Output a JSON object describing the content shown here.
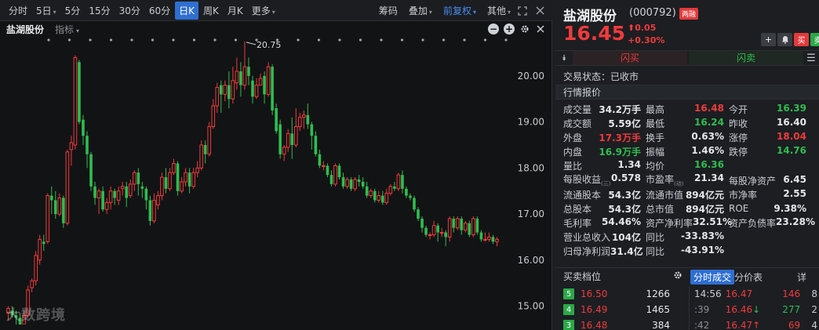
{
  "toolbar": {
    "tabs": [
      {
        "label": "分时",
        "active": false
      },
      {
        "label": "5日",
        "active": false,
        "caret": true
      },
      {
        "label": "5分",
        "active": false
      },
      {
        "label": "15分",
        "active": false
      },
      {
        "label": "30分",
        "active": false
      },
      {
        "label": "60分",
        "active": false
      },
      {
        "label": "日K",
        "active": true
      },
      {
        "label": "周K",
        "active": false
      },
      {
        "label": "月K",
        "active": false
      },
      {
        "label": "更多",
        "active": false,
        "caret": true
      }
    ],
    "right": {
      "chip": "筹码",
      "overlay": "叠加",
      "adjust": "前复权",
      "other": "其他"
    }
  },
  "chart_header": {
    "stock": "盐湖股份",
    "indicator": "指标"
  },
  "chart_data": {
    "type": "candlestick",
    "y_ticks": [
      "20.00",
      "19.00",
      "18.00",
      "17.00",
      "16.00",
      "15.00"
    ],
    "ylim": [
      14.6,
      20.85
    ],
    "max_label": "20.75",
    "colors": {
      "up": "#ef3b3b",
      "down": "#2fbd4f"
    },
    "candles": [
      [
        14.85,
        14.95,
        14.7,
        15.0
      ],
      [
        14.9,
        14.8,
        14.75,
        15.0
      ],
      [
        14.8,
        14.75,
        14.6,
        14.9
      ],
      [
        14.75,
        14.6,
        14.5,
        14.85
      ],
      [
        14.6,
        14.8,
        14.55,
        14.9
      ],
      [
        14.8,
        15.35,
        14.75,
        15.45
      ],
      [
        15.4,
        15.55,
        15.3,
        15.6
      ],
      [
        15.55,
        16.1,
        15.45,
        16.2
      ],
      [
        16.0,
        16.45,
        15.9,
        16.55
      ],
      [
        16.4,
        16.35,
        16.2,
        16.55
      ],
      [
        16.4,
        17.4,
        16.35,
        17.45
      ],
      [
        17.4,
        17.3,
        17.0,
        17.6
      ],
      [
        17.3,
        17.0,
        16.9,
        17.5
      ],
      [
        17.0,
        17.35,
        16.95,
        17.45
      ],
      [
        17.35,
        16.8,
        16.7,
        17.4
      ],
      [
        16.8,
        18.35,
        16.75,
        18.4
      ],
      [
        18.4,
        18.55,
        18.05,
        18.7
      ],
      [
        18.5,
        20.4,
        18.4,
        20.45
      ],
      [
        20.3,
        19.0,
        18.95,
        20.35
      ],
      [
        19.05,
        18.7,
        18.5,
        19.15
      ],
      [
        18.7,
        18.3,
        18.0,
        18.8
      ],
      [
        18.3,
        17.6,
        17.5,
        18.35
      ],
      [
        17.6,
        17.35,
        17.2,
        17.7
      ],
      [
        17.35,
        17.5,
        17.0,
        17.55
      ],
      [
        17.5,
        17.1,
        17.05,
        17.6
      ],
      [
        17.1,
        17.25,
        17.0,
        17.35
      ],
      [
        17.25,
        17.5,
        17.1,
        17.6
      ],
      [
        17.5,
        17.35,
        17.2,
        17.55
      ],
      [
        17.3,
        17.5,
        17.2,
        17.6
      ],
      [
        17.55,
        17.6,
        17.4,
        17.7
      ],
      [
        17.6,
        17.35,
        17.15,
        17.7
      ],
      [
        17.4,
        17.65,
        17.35,
        17.75
      ],
      [
        17.65,
        17.9,
        17.5,
        17.95
      ],
      [
        17.9,
        17.65,
        17.4,
        18.0
      ],
      [
        17.6,
        17.55,
        17.35,
        17.7
      ],
      [
        17.55,
        17.3,
        17.1,
        17.6
      ],
      [
        17.3,
        16.85,
        16.75,
        17.4
      ],
      [
        16.85,
        17.3,
        16.8,
        17.45
      ],
      [
        17.2,
        17.4,
        17.1,
        17.5
      ],
      [
        17.4,
        17.8,
        17.3,
        17.9
      ],
      [
        17.8,
        17.55,
        17.45,
        18.0
      ],
      [
        17.55,
        17.9,
        17.5,
        18.0
      ],
      [
        17.9,
        18.1,
        17.85,
        18.2
      ],
      [
        18.1,
        17.5,
        17.4,
        18.15
      ],
      [
        17.5,
        17.7,
        17.45,
        17.8
      ],
      [
        17.7,
        17.9,
        17.6,
        18.0
      ],
      [
        17.9,
        17.6,
        17.45,
        18.0
      ],
      [
        17.6,
        17.9,
        17.55,
        18.0
      ],
      [
        17.9,
        18.0,
        17.8,
        18.15
      ],
      [
        18.0,
        18.5,
        17.95,
        18.6
      ],
      [
        18.5,
        18.3,
        18.1,
        18.6
      ],
      [
        18.3,
        18.9,
        18.25,
        19.0
      ],
      [
        18.9,
        19.35,
        18.85,
        19.5
      ],
      [
        19.35,
        19.75,
        19.2,
        19.85
      ],
      [
        19.8,
        19.6,
        19.2,
        19.9
      ],
      [
        19.6,
        19.8,
        19.45,
        19.9
      ],
      [
        19.8,
        19.5,
        19.3,
        20.1
      ],
      [
        19.5,
        19.9,
        19.4,
        20.2
      ],
      [
        19.85,
        20.1,
        19.7,
        20.4
      ],
      [
        20.1,
        19.8,
        19.55,
        20.3
      ],
      [
        19.8,
        20.2,
        19.7,
        20.75
      ],
      [
        20.2,
        20.0,
        19.8,
        20.4
      ],
      [
        19.9,
        19.55,
        19.4,
        20.0
      ],
      [
        19.55,
        19.8,
        19.5,
        19.95
      ],
      [
        19.8,
        19.95,
        19.8,
        20.05
      ],
      [
        20.0,
        19.6,
        19.4,
        20.1
      ],
      [
        19.6,
        20.2,
        19.55,
        20.3
      ],
      [
        20.2,
        19.25,
        19.15,
        20.25
      ],
      [
        19.3,
        18.8,
        18.75,
        19.4
      ],
      [
        18.95,
        18.3,
        18.2,
        19.05
      ],
      [
        18.3,
        18.45,
        18.15,
        18.5
      ],
      [
        18.45,
        18.75,
        18.35,
        18.85
      ],
      [
        18.75,
        18.5,
        18.2,
        19.1
      ],
      [
        18.5,
        18.9,
        18.45,
        19.3
      ],
      [
        18.9,
        19.1,
        18.8,
        19.2
      ],
      [
        19.1,
        19.15,
        18.85,
        19.25
      ],
      [
        19.15,
        18.95,
        18.85,
        19.4
      ],
      [
        18.95,
        18.7,
        18.4,
        19.0
      ],
      [
        18.7,
        18.3,
        18.25,
        18.8
      ],
      [
        18.3,
        18.05,
        18.0,
        18.4
      ],
      [
        18.05,
        18.05,
        17.95,
        18.15
      ],
      [
        18.05,
        17.85,
        17.8,
        18.1
      ],
      [
        17.85,
        17.65,
        17.6,
        17.95
      ],
      [
        17.65,
        18.05,
        17.6,
        18.1
      ],
      [
        18.05,
        17.8,
        17.75,
        18.1
      ],
      [
        17.8,
        17.6,
        17.55,
        17.9
      ],
      [
        17.6,
        17.75,
        17.55,
        17.8
      ],
      [
        17.75,
        17.55,
        17.5,
        17.8
      ],
      [
        17.55,
        17.75,
        17.5,
        17.8
      ],
      [
        17.75,
        17.7,
        17.6,
        17.85
      ],
      [
        17.7,
        17.6,
        17.55,
        17.8
      ],
      [
        17.6,
        17.4,
        17.35,
        17.7
      ],
      [
        17.4,
        17.5,
        17.35,
        17.55
      ],
      [
        17.5,
        17.3,
        17.25,
        17.55
      ],
      [
        17.3,
        17.4,
        17.25,
        17.5
      ],
      [
        17.4,
        17.25,
        17.2,
        17.5
      ],
      [
        17.25,
        17.45,
        17.2,
        17.55
      ],
      [
        17.45,
        17.6,
        17.4,
        17.65
      ],
      [
        17.6,
        17.55,
        17.5,
        17.7
      ],
      [
        17.55,
        17.85,
        17.5,
        17.9
      ],
      [
        17.85,
        17.55,
        17.45,
        17.95
      ],
      [
        17.55,
        17.4,
        17.35,
        17.6
      ],
      [
        17.4,
        17.35,
        17.3,
        17.45
      ],
      [
        17.35,
        17.1,
        17.05,
        17.4
      ],
      [
        17.1,
        16.9,
        16.85,
        17.15
      ],
      [
        16.9,
        16.7,
        16.6,
        16.95
      ],
      [
        16.7,
        16.55,
        16.5,
        16.75
      ],
      [
        16.55,
        16.55,
        16.45,
        16.6
      ],
      [
        16.55,
        16.75,
        16.5,
        16.85
      ],
      [
        16.75,
        16.6,
        16.4,
        16.8
      ],
      [
        16.6,
        16.6,
        16.5,
        16.7
      ],
      [
        16.6,
        16.5,
        16.3,
        16.65
      ],
      [
        16.5,
        16.9,
        16.4,
        16.95
      ],
      [
        16.9,
        16.7,
        16.6,
        16.95
      ],
      [
        16.7,
        16.9,
        16.65,
        16.95
      ],
      [
        16.9,
        16.65,
        16.55,
        16.95
      ],
      [
        16.65,
        16.8,
        16.6,
        16.85
      ],
      [
        16.8,
        16.55,
        16.5,
        16.85
      ],
      [
        16.55,
        16.9,
        16.5,
        16.95
      ],
      [
        16.9,
        16.6,
        16.55,
        16.95
      ],
      [
        16.6,
        16.45,
        16.4,
        16.65
      ],
      [
        16.45,
        16.45,
        16.4,
        16.6
      ],
      [
        16.45,
        16.5,
        16.4,
        16.6
      ],
      [
        16.5,
        16.4,
        16.35,
        16.55
      ],
      [
        16.4,
        16.45,
        16.3,
        16.5
      ]
    ]
  },
  "watermark": "大数跨境",
  "stock": {
    "name": "盐湖股份",
    "code": "(000792)",
    "badge": "两融",
    "price": "16.45",
    "change": "0.05",
    "change_pct": "+0.30%"
  },
  "header_buttons": {
    "add": "+",
    "bell": "♪",
    "buy": "买",
    "sell": "卖"
  },
  "flash": {
    "buy": "闪买",
    "sell": "闪卖"
  },
  "trade_status": "交易状态：已收市",
  "quote_title": "行情报价",
  "quotes": [
    [
      {
        "label": "成交量",
        "value": "34.2万手",
        "color": "white"
      },
      {
        "label": "最高",
        "value": "16.48",
        "color": "red"
      },
      {
        "label": "今开",
        "value": "16.39",
        "color": "green"
      }
    ],
    [
      {
        "label": "成交额",
        "value": "5.59亿",
        "color": "white"
      },
      {
        "label": "最低",
        "value": "16.24",
        "color": "green"
      },
      {
        "label": "昨收",
        "value": "16.40",
        "color": "white"
      }
    ],
    [
      {
        "label": "外盘",
        "value": "17.3万手",
        "color": "red"
      },
      {
        "label": "换手",
        "value": "0.63%",
        "color": "white"
      },
      {
        "label": "涨停",
        "value": "18.04",
        "color": "red"
      }
    ],
    [
      {
        "label": "内盘",
        "value": "16.9万手",
        "color": "green"
      },
      {
        "label": "振幅",
        "value": "1.46%",
        "color": "white"
      },
      {
        "label": "跌停",
        "value": "14.76",
        "color": "green"
      }
    ],
    [
      {
        "label": "量比",
        "value": "1.34",
        "color": "white"
      },
      {
        "label": "均价",
        "value": "16.36",
        "color": "green"
      },
      {
        "label": "",
        "value": "",
        "color": "white"
      }
    ],
    [
      {
        "label": "每股收益",
        "sub": "(三)",
        "value": "0.578",
        "color": "white"
      },
      {
        "label": "市盈率",
        "sub": "(动)",
        "value": "21.34",
        "color": "white"
      },
      {
        "label": "每股净资产",
        "value": "6.45",
        "color": "white"
      }
    ],
    [
      {
        "label": "流通股本",
        "value": "54.3亿",
        "color": "white"
      },
      {
        "label": "流通市值",
        "value": "894亿元",
        "color": "white"
      },
      {
        "label": "市净率",
        "value": "2.55",
        "color": "white"
      }
    ],
    [
      {
        "label": "总股本",
        "value": "54.3亿",
        "color": "white"
      },
      {
        "label": "总市值",
        "value": "894亿元",
        "color": "white"
      },
      {
        "label": "ROE",
        "value": "9.38%",
        "color": "white"
      }
    ],
    [
      {
        "label": "毛利率",
        "value": "54.46%",
        "color": "white"
      },
      {
        "label": "资产净利率",
        "value": "32.51%",
        "color": "white"
      },
      {
        "label": "资产负债率",
        "value": "23.28%",
        "color": "white"
      }
    ],
    [
      {
        "label": "营业总收入",
        "value": "104亿",
        "color": "white"
      },
      {
        "label": "同比",
        "value": "-33.83%",
        "color": "white"
      },
      {
        "label": "",
        "value": "",
        "color": "white"
      }
    ],
    [
      {
        "label": "归母净利润",
        "value": "31.4亿",
        "color": "white"
      },
      {
        "label": "同比",
        "value": "-43.91%",
        "color": "white"
      },
      {
        "label": "",
        "value": "",
        "color": "white"
      }
    ]
  ],
  "orderbook": {
    "title": "买卖档位",
    "tab_ticks": "分时成交",
    "tab_price": "分价表",
    "tab_detail": "详",
    "rows": [
      {
        "level": "5",
        "price": "16.50",
        "vol": "1266"
      },
      {
        "level": "4",
        "price": "16.49",
        "vol": "1465"
      },
      {
        "level": "3",
        "price": "16.48",
        "vol": "384"
      }
    ]
  },
  "ticks": [
    {
      "time": "14:56",
      "price": "16.47",
      "arrow": "",
      "vol": "146",
      "vol_color": "red",
      "n": "8"
    },
    {
      "time": ":39",
      "price": "16.46",
      "arrow": "↓",
      "vol": "277",
      "vol_color": "green",
      "n": "2"
    },
    {
      "time": ":42",
      "price": "16.47",
      "arrow": "↑",
      "vol": "69",
      "vol_color": "red",
      "n": "4"
    }
  ]
}
